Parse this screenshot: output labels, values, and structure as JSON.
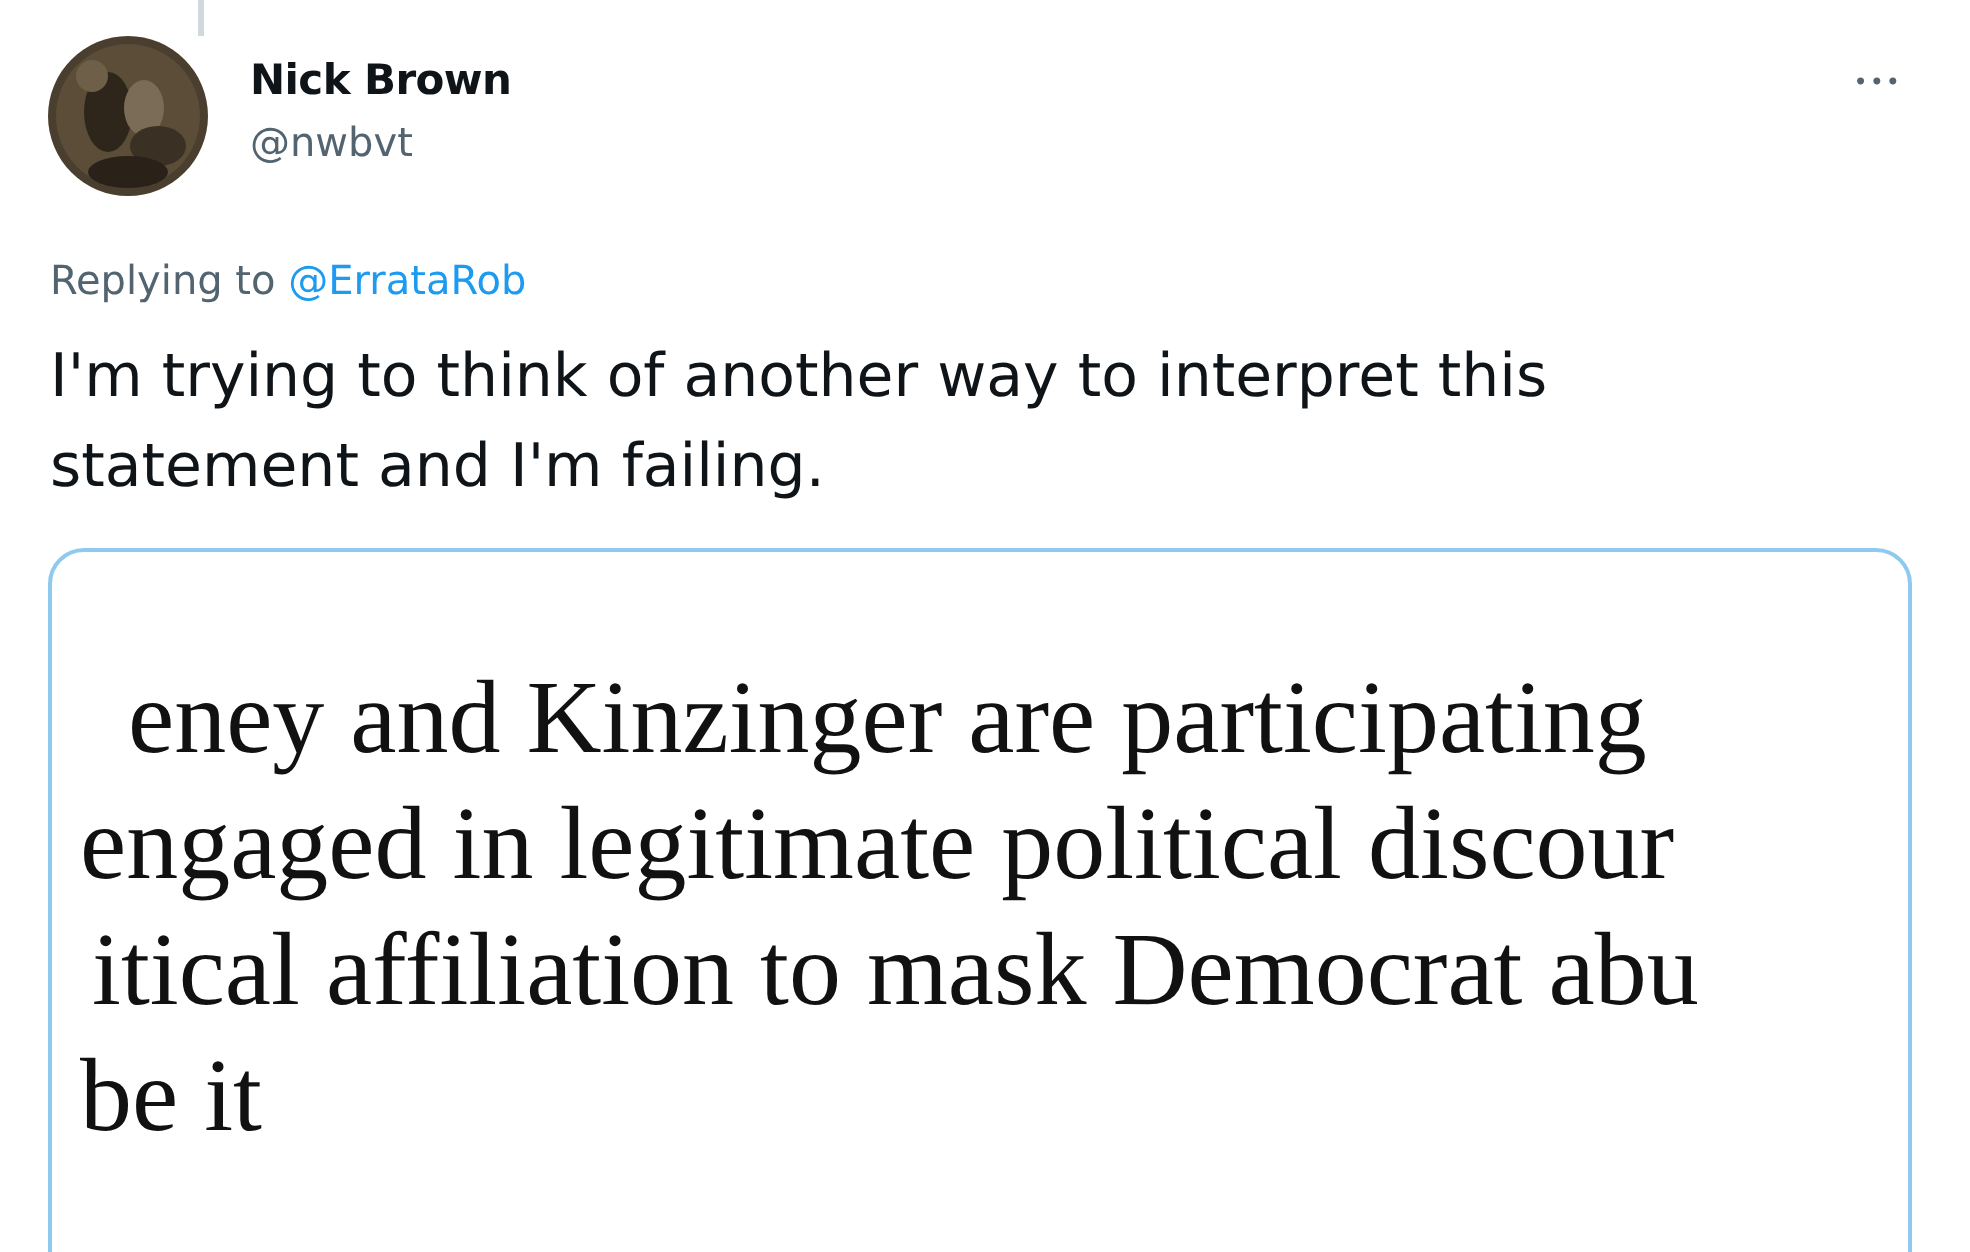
{
  "tweet": {
    "author": {
      "name": "Nick Brown",
      "handle": "@nwbvt"
    },
    "more_menu": "•••",
    "reply_context": {
      "label": "Replying to",
      "mention": "@ErrataRob"
    },
    "text": "I'm trying to think of another way to interpret this statement and I'm failing.",
    "attached_document": {
      "lines": [
        "eney and Kinzinger are participating",
        "engaged in legitimate political discour",
        "itical affiliation to mask Democrat abu",
        "be it"
      ]
    }
  }
}
